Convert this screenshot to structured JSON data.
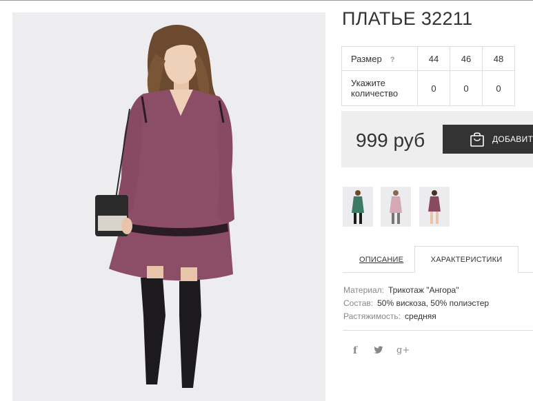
{
  "product": {
    "title": "ПЛАТЬЕ 32211",
    "main_image": "model-in-purple-dress-photo"
  },
  "size_table": {
    "size_label": "Размер",
    "help_icon": "?",
    "quantity_label": "Укажите количество",
    "sizes": [
      "44",
      "46",
      "48"
    ],
    "quantities": [
      "0",
      "0",
      "0"
    ]
  },
  "price": {
    "value": "999 руб",
    "add_button_label": "ДОБАВИТЬ",
    "bag_icon": "shopping-bag-icon"
  },
  "thumbnails": [
    {
      "name": "green-dress-thumbnail",
      "color": "#3d7a66"
    },
    {
      "name": "pink-dress-thumbnail",
      "color": "#d4a8b4"
    },
    {
      "name": "purple-dress-thumbnail",
      "color": "#8a4a5e"
    }
  ],
  "tabs": {
    "description": "ОПИСАНИЕ",
    "specs": "ХАРАКТЕРИСТИКИ",
    "active": "specs"
  },
  "specs": [
    {
      "key": "Материал:",
      "value": "Трикотаж \"Ангора\""
    },
    {
      "key": "Состав:",
      "value": "50% вискоза, 50% полиэстер"
    },
    {
      "key": "Растяжимость:",
      "value": "средняя"
    }
  ],
  "social": {
    "facebook": "f",
    "twitter": "🐦",
    "google_plus": "g+"
  },
  "colors": {
    "dark_button": "#333333",
    "price_bg": "#eeeeee",
    "dress": "#8c4d66"
  }
}
